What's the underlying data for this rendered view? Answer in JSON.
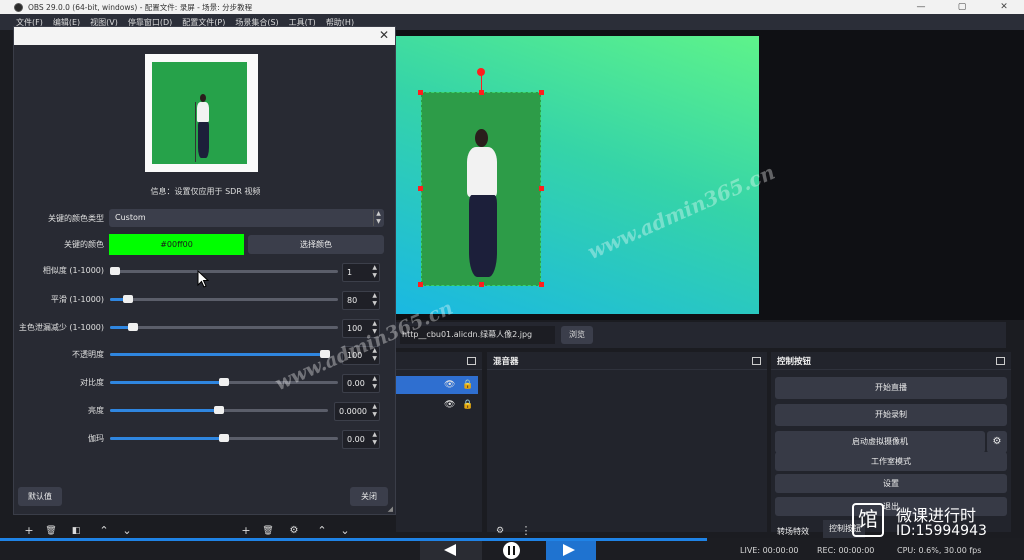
{
  "window": {
    "title": "OBS 29.0.0 (64-bit, windows) - 配置文件: 录屏 - 场景: 分步教程",
    "minimize": "—",
    "maximize": "▢",
    "close": "✕"
  },
  "menu": [
    "文件(F)",
    "编辑(E)",
    "视图(V)",
    "停靠窗口(D)",
    "配置文件(P)",
    "场景集合(S)",
    "工具(T)",
    "帮助(H)"
  ],
  "source_bar": {
    "path": "http__cbu01.alicdn.绿幕人像2.jpg",
    "browse_label": "浏览"
  },
  "docks": {
    "mixer_title": "混音器",
    "controls_title": "控制按钮",
    "controls": {
      "start_stream": "开始直播",
      "start_record": "开始录制",
      "virtual_cam": "启动虚拟摄像机",
      "studio_mode": "工作室模式",
      "settings": "设置",
      "exit": "退出",
      "transition": "转场特效",
      "control_tab": "控制按钮"
    }
  },
  "dialog": {
    "close": "✕",
    "info": "信息：设置仅应用于 SDR 视频",
    "key_color_type_label": "关键的颜色类型",
    "key_color_type_value": "Custom",
    "key_color_label": "关键的颜色",
    "key_color_value": "#00ff00",
    "pick_color_label": "选择颜色",
    "similarity_label": "相似度 (1-1000)",
    "similarity_value": "1",
    "smoothness_label": "平滑 (1-1000)",
    "smoothness_value": "80",
    "spill_label": "主色泄漏减少 (1-1000)",
    "spill_value": "100",
    "opacity_label": "不透明度",
    "opacity_value": "100",
    "contrast_label": "对比度",
    "contrast_value": "0.00",
    "brightness_label": "亮度",
    "brightness_value": "0.0000",
    "gamma_label": "伽玛",
    "gamma_value": "0.00",
    "defaults_label": "默认值",
    "close_label": "关闭",
    "sliders": {
      "similarity": 0.001,
      "smoothness": 0.08,
      "spill": 0.1,
      "opacity": 1.0,
      "contrast": 0.5,
      "brightness": 0.5,
      "gamma": 0.5
    }
  },
  "status": {
    "live": "LIVE: 00:00:00",
    "rec": "REC: 00:00:00",
    "cpu": "CPU: 0.6%, 30.00 fps",
    "progress": 0.69
  },
  "watermark": "www.admin365.cn",
  "overlay": {
    "logo_glyph": "馆",
    "line1": "微课进行时",
    "line2": "ID:15994943"
  },
  "colors": {
    "accent": "#1f83e6",
    "key_green": "#00ff00",
    "handle": "#ff1e1e"
  }
}
